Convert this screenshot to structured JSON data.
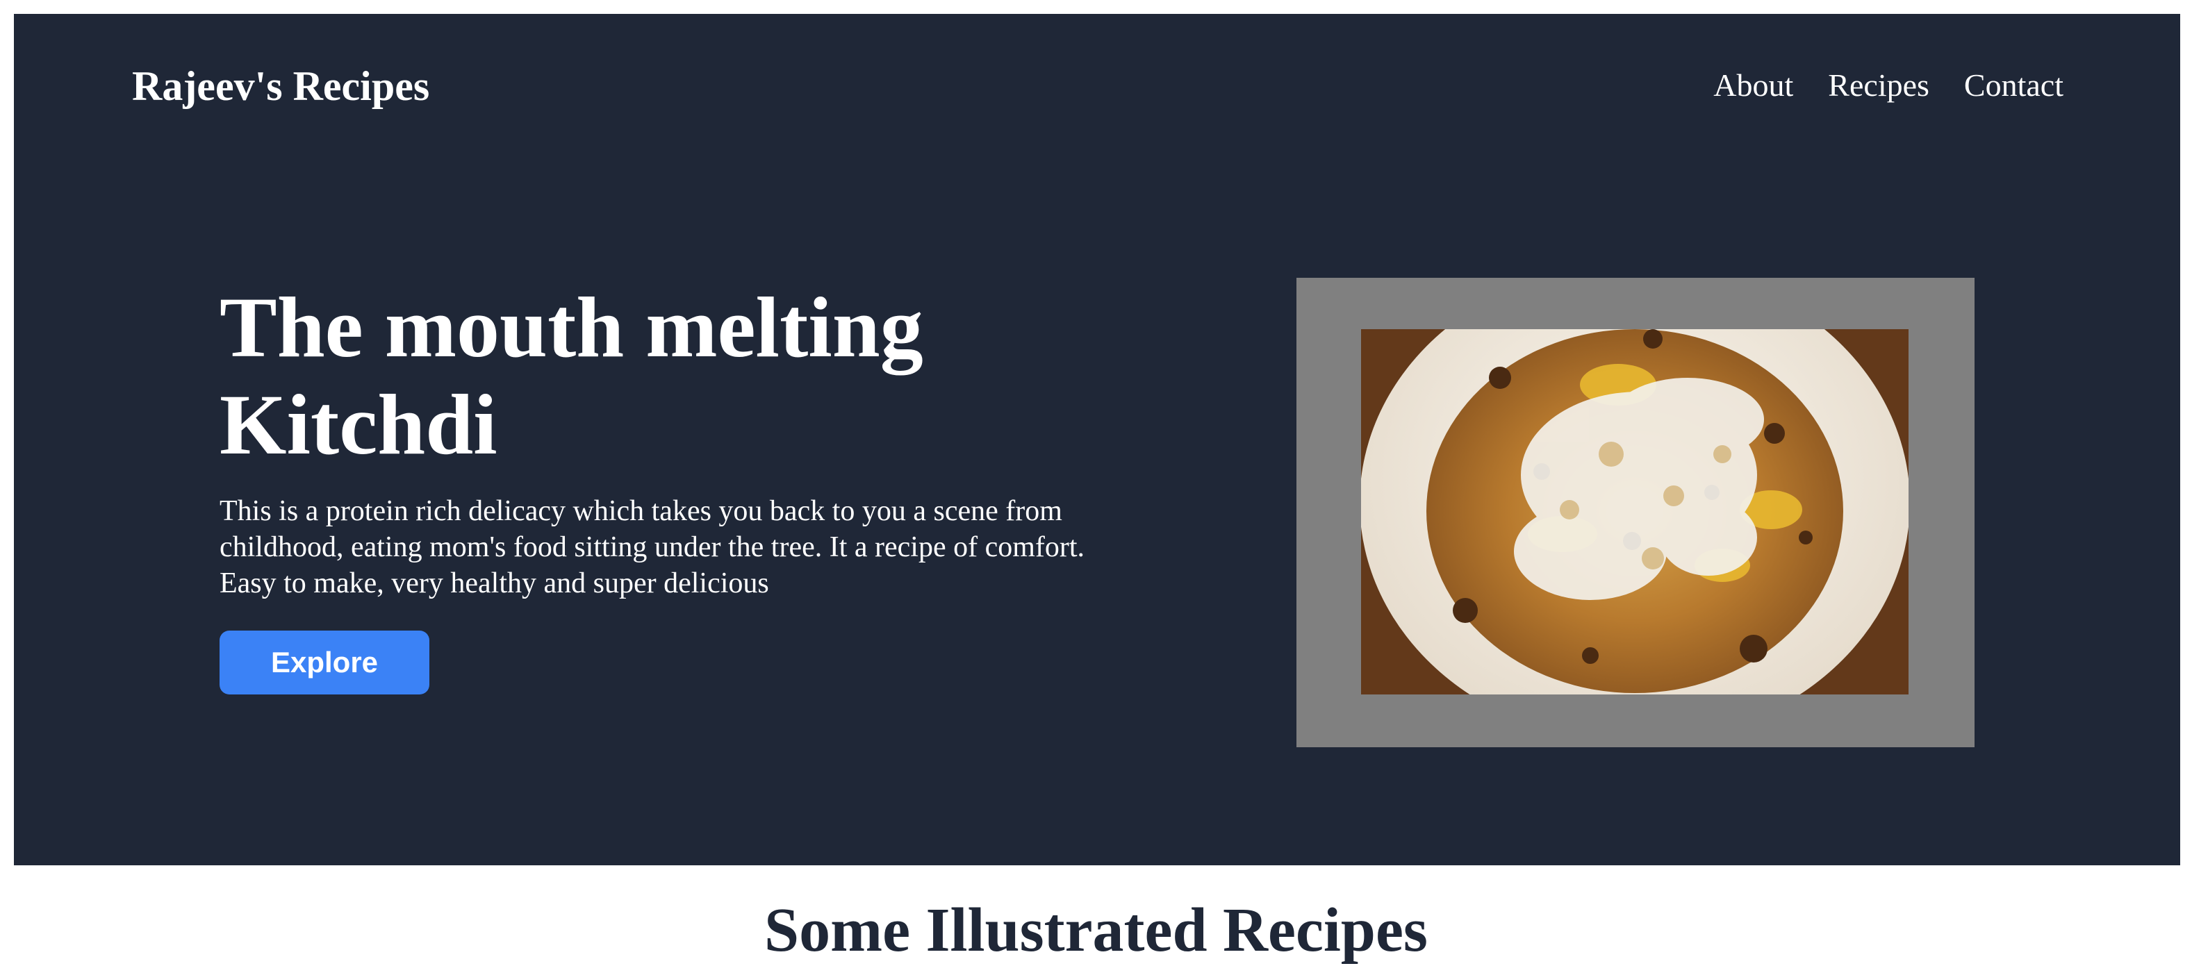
{
  "header": {
    "brand": "Rajeev's Recipes",
    "nav": [
      {
        "label": "About"
      },
      {
        "label": "Recipes"
      },
      {
        "label": "Contact"
      }
    ]
  },
  "hero": {
    "title": "The mouth melting Kitchdi",
    "description": "This is a protein rich delicacy which takes you back to you a scene from childhood, eating mom's food sitting under the tree. It a recipe of comfort. Easy to make, very healthy and super delicious",
    "cta_label": "Explore",
    "image_subject": "kitchdi-bowl"
  },
  "sections": {
    "illustrated_title": "Some Illustrated Recipes"
  },
  "colors": {
    "hero_bg": "#1f2737",
    "accent": "#3b82f6",
    "image_frame": "#808080",
    "page_bg": "#ffffff"
  }
}
